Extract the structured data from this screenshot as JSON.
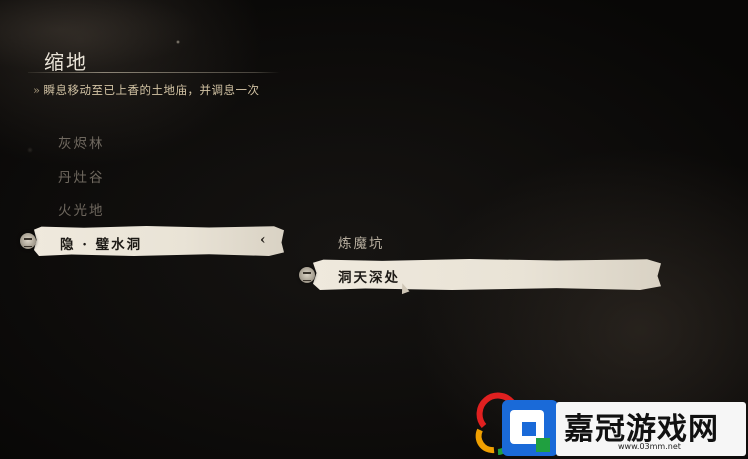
{
  "menu": {
    "title": "缩地",
    "subtitle_arrow": "»",
    "subtitle": "瞬息移动至已上香的土地庙，并调息一次"
  },
  "locations": [
    {
      "label": "灰烬林",
      "selected": false
    },
    {
      "label": "丹灶谷",
      "selected": false
    },
    {
      "label": "火光地",
      "selected": false
    },
    {
      "label": "隐 · 璧水洞",
      "selected": true
    }
  ],
  "selected_chevron": "‹",
  "sublocations": [
    {
      "label": "炼魔坑",
      "selected": false
    },
    {
      "label": "洞天深处",
      "selected": true
    }
  ],
  "icons": {
    "left": "shrine-icon",
    "right": "shrine-icon",
    "cursor": "cursor-icon"
  },
  "watermark": {
    "name": "嘉冠游戏网",
    "url": "www.03mm.net"
  },
  "colors": {
    "highlight": "#efe9dd",
    "title": "#e8e2d6",
    "subtitle": "#d2c3a4",
    "inactive": "#6f685f"
  }
}
